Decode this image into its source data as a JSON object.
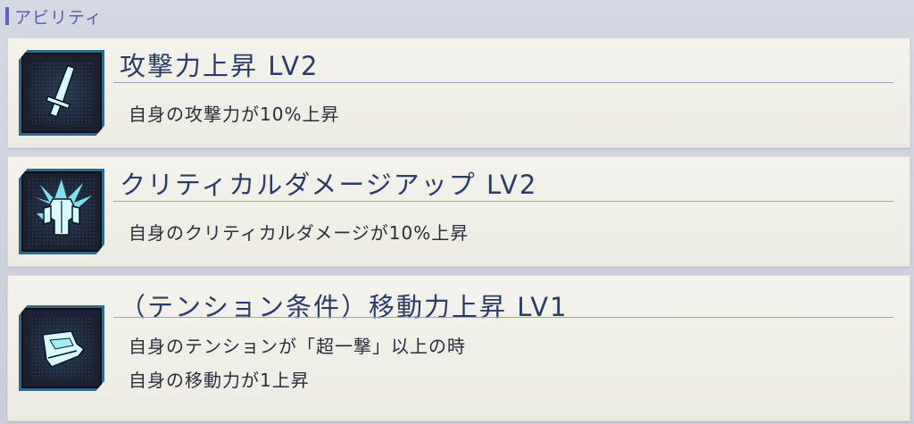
{
  "section": {
    "title": "アビリティ"
  },
  "abilities": [
    {
      "title": "攻撃力上昇 LV2",
      "desc_lines": [
        "自身の攻撃力が10%上昇"
      ],
      "icon": "sword-icon"
    },
    {
      "title": "クリティカルダメージアップ LV2",
      "desc_lines": [
        "自身のクリティカルダメージが10%上昇"
      ],
      "icon": "armor-burst-icon"
    },
    {
      "title": "（テンション条件）移動力上昇 LV1",
      "desc_lines": [
        "自身のテンションが「超一撃」以上の時",
        "自身の移動力が1上昇"
      ],
      "icon": "boot-icon"
    }
  ],
  "colors": {
    "accent": "#5a62c8",
    "title_text": "#2a3c66",
    "icon_glow": "#7fe3ef"
  }
}
